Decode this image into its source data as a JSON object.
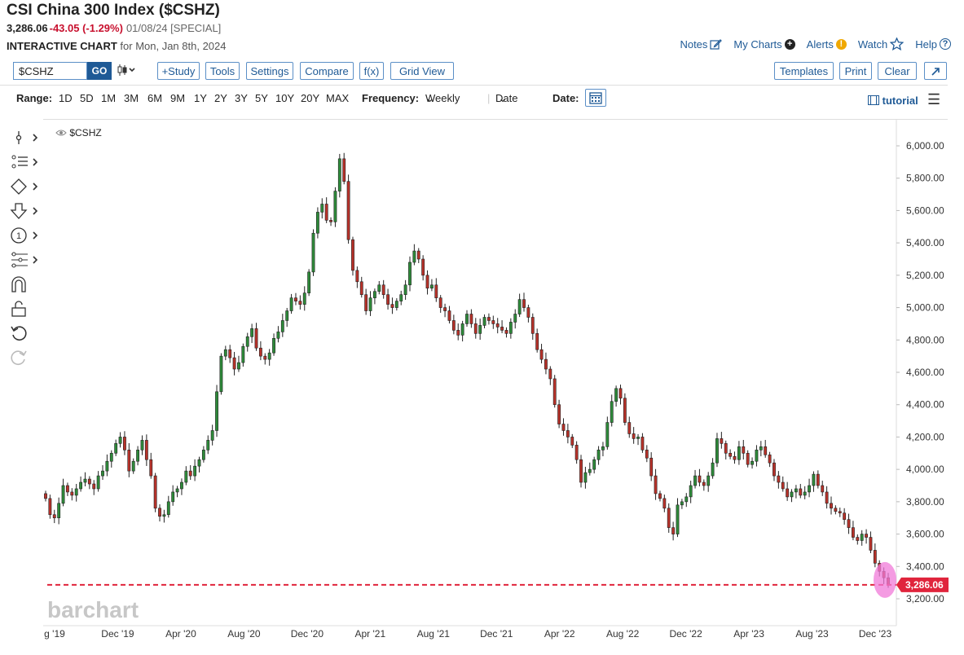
{
  "header": {
    "title": "CSI China 300 Index ($CSHZ)",
    "last": "3,286.06",
    "change": "-43.05 (-1.29%)",
    "meta": "01/08/24 [SPECIAL]",
    "subtitle_bold": "INTERACTIVE CHART",
    "subtitle_rest": "for Mon, Jan 8th, 2024"
  },
  "top_links": {
    "notes": "Notes",
    "my_charts": "My Charts",
    "alerts": "Alerts",
    "watch": "Watch",
    "help": "Help"
  },
  "toolbar": {
    "symbol_value": "$CSHZ",
    "go": "GO",
    "study": "+Study",
    "tools": "Tools",
    "settings": "Settings",
    "compare": "Compare",
    "fx": "f(x)",
    "grid_view": "Grid View",
    "templates": "Templates",
    "print": "Print",
    "clear": "Clear"
  },
  "range_bar": {
    "range_label": "Range:",
    "ranges": [
      "1D",
      "5D",
      "1M",
      "3M",
      "6M",
      "9M",
      "1Y",
      "2Y",
      "3Y",
      "5Y",
      "10Y",
      "20Y",
      "MAX"
    ],
    "frequency_label": "Frequency:",
    "frequency_value": "Weekly",
    "date_select": "Date",
    "date_label": "Date:",
    "tutorial": "tutorial"
  },
  "colors": {
    "up": "#2e8b3a",
    "down": "#b8322a",
    "price_line": "#e0243c",
    "highlight": "#f07ad8",
    "axis_text": "#333333",
    "link": "#1f5a96"
  },
  "chart_data": {
    "type": "candlestick",
    "symbol": "$CSHZ",
    "frequency": "weekly",
    "y_ticks": [
      "6,000.00",
      "5,800.00",
      "5,600.00",
      "5,400.00",
      "5,200.00",
      "5,000.00",
      "4,800.00",
      "4,600.00",
      "4,400.00",
      "4,200.00",
      "4,000.00",
      "3,800.00",
      "3,600.00",
      "3,400.00",
      "3,200.00"
    ],
    "x_ticks": [
      "g '19",
      "Dec '19",
      "Apr '20",
      "Aug '20",
      "Dec '20",
      "Apr '21",
      "Aug '21",
      "Dec '21",
      "Apr '22",
      "Aug '22",
      "Dec '22",
      "Apr '23",
      "Aug '23",
      "Dec '23"
    ],
    "ylim": [
      3150,
      6150
    ],
    "last_price": 3286.06,
    "last_price_label": "3,286.06",
    "watermark": "barchart",
    "closes": [
      3820,
      3720,
      3700,
      3790,
      3900,
      3860,
      3840,
      3880,
      3920,
      3940,
      3910,
      3880,
      3960,
      3990,
      4050,
      4100,
      4160,
      4200,
      4120,
      3990,
      4050,
      4120,
      4180,
      4060,
      3960,
      3760,
      3710,
      3720,
      3800,
      3860,
      3880,
      3920,
      3990,
      3960,
      4020,
      4060,
      4120,
      4180,
      4240,
      4480,
      4700,
      4740,
      4690,
      4620,
      4660,
      4760,
      4820,
      4870,
      4750,
      4700,
      4680,
      4720,
      4810,
      4850,
      4920,
      4980,
      5060,
      5040,
      5020,
      5090,
      5220,
      5460,
      5590,
      5640,
      5540,
      5530,
      5720,
      5920,
      5780,
      5420,
      5230,
      5160,
      5080,
      4980,
      5060,
      5100,
      5140,
      5080,
      5020,
      5000,
      5040,
      5080,
      5140,
      5280,
      5350,
      5300,
      5200,
      5120,
      5140,
      5060,
      5000,
      4980,
      4920,
      4860,
      4830,
      4900,
      4960,
      4900,
      4840,
      4890,
      4940,
      4920,
      4900,
      4880,
      4860,
      4840,
      4910,
      4960,
      5050,
      5000,
      4940,
      4840,
      4740,
      4680,
      4620,
      4560,
      4400,
      4280,
      4240,
      4200,
      4150,
      4060,
      3920,
      3980,
      4000,
      4060,
      4120,
      4140,
      4290,
      4420,
      4500,
      4440,
      4290,
      4220,
      4190,
      4200,
      4120,
      4070,
      3960,
      3850,
      3820,
      3760,
      3640,
      3600,
      3780,
      3800,
      3830,
      3900,
      3960,
      3920,
      3900,
      3960,
      4040,
      4190,
      4160,
      4100,
      4080,
      4060,
      4140,
      4100,
      4030,
      4050,
      4120,
      4140,
      4090,
      4040,
      3960,
      3920,
      3880,
      3830,
      3860,
      3880,
      3840,
      3860,
      3900,
      3970,
      3900,
      3860,
      3790,
      3760,
      3740,
      3730,
      3690,
      3640,
      3580,
      3560,
      3600,
      3580,
      3500,
      3420,
      3370,
      3330,
      3286
    ]
  }
}
